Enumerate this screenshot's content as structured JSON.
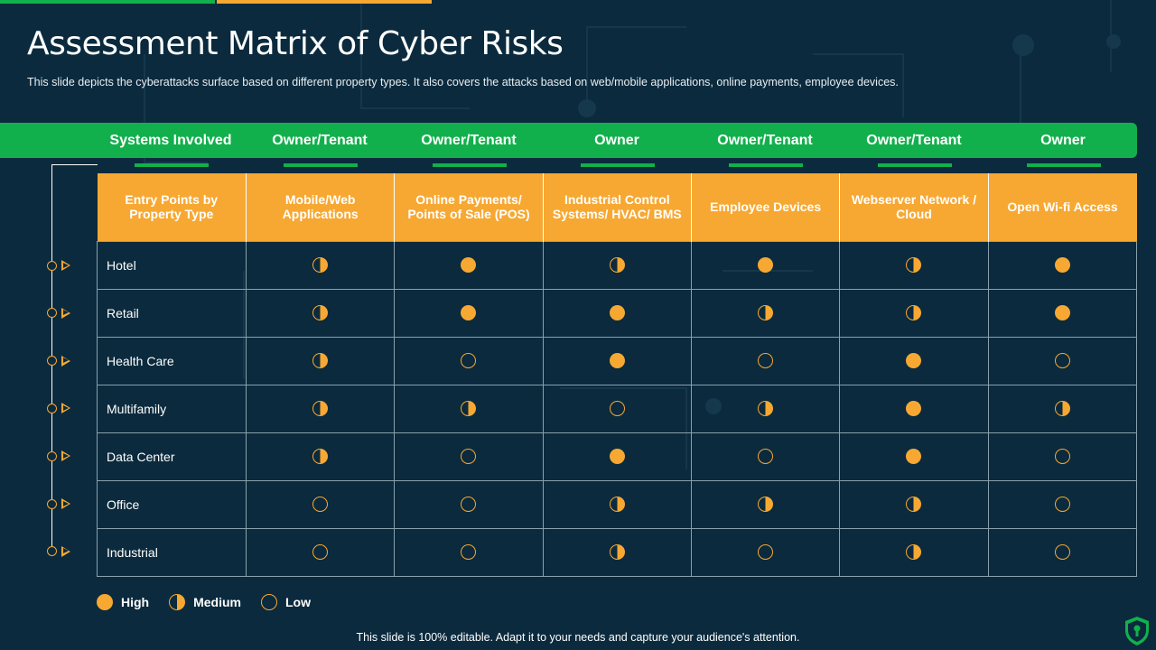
{
  "slide": {
    "title": "Assessment Matrix of Cyber Risks",
    "subtitle": "This slide depicts the cyberattacks surface based on different property types. It also covers the attacks based on web/mobile applications, online payments, employee devices.",
    "footer": "This slide is 100% editable. Adapt it to your needs and capture your audience's attention."
  },
  "colors": {
    "background": "#0b2a3d",
    "green": "#12b04c",
    "orange": "#f7a832"
  },
  "systems_band": [
    "Systems Involved",
    "Owner/Tenant",
    "Owner/Tenant",
    "Owner",
    "Owner/Tenant",
    "Owner/Tenant",
    "Owner"
  ],
  "matrix": {
    "headers": [
      "Entry Points by Property Type",
      "Mobile/Web Applications",
      "Online Payments/ Points of Sale (POS)",
      "Industrial Control Systems/ HVAC/ BMS",
      "Employee Devices",
      "Webserver Network / Cloud",
      "Open Wi-fi Access"
    ],
    "rows": [
      {
        "label": "Hotel",
        "levels": [
          "medium",
          "high",
          "medium",
          "high",
          "medium",
          "high"
        ]
      },
      {
        "label": "Retail",
        "levels": [
          "medium",
          "high",
          "high",
          "medium",
          "medium",
          "high"
        ]
      },
      {
        "label": "Health Care",
        "levels": [
          "medium",
          "low",
          "high",
          "low",
          "high",
          "low"
        ]
      },
      {
        "label": "Multifamily",
        "levels": [
          "medium",
          "medium",
          "low",
          "medium",
          "high",
          "medium"
        ]
      },
      {
        "label": "Data Center",
        "levels": [
          "medium",
          "low",
          "high",
          "low",
          "high",
          "low"
        ]
      },
      {
        "label": "Office",
        "levels": [
          "low",
          "low",
          "medium",
          "medium",
          "medium",
          "low"
        ]
      },
      {
        "label": "Industrial",
        "levels": [
          "low",
          "low",
          "medium",
          "low",
          "medium",
          "low"
        ]
      }
    ]
  },
  "legend": {
    "high": "High",
    "medium": "Medium",
    "low": "Low"
  },
  "icons": {
    "row_marker": "circle-triangle-marker-icon",
    "shield": "shield-lock-icon"
  }
}
